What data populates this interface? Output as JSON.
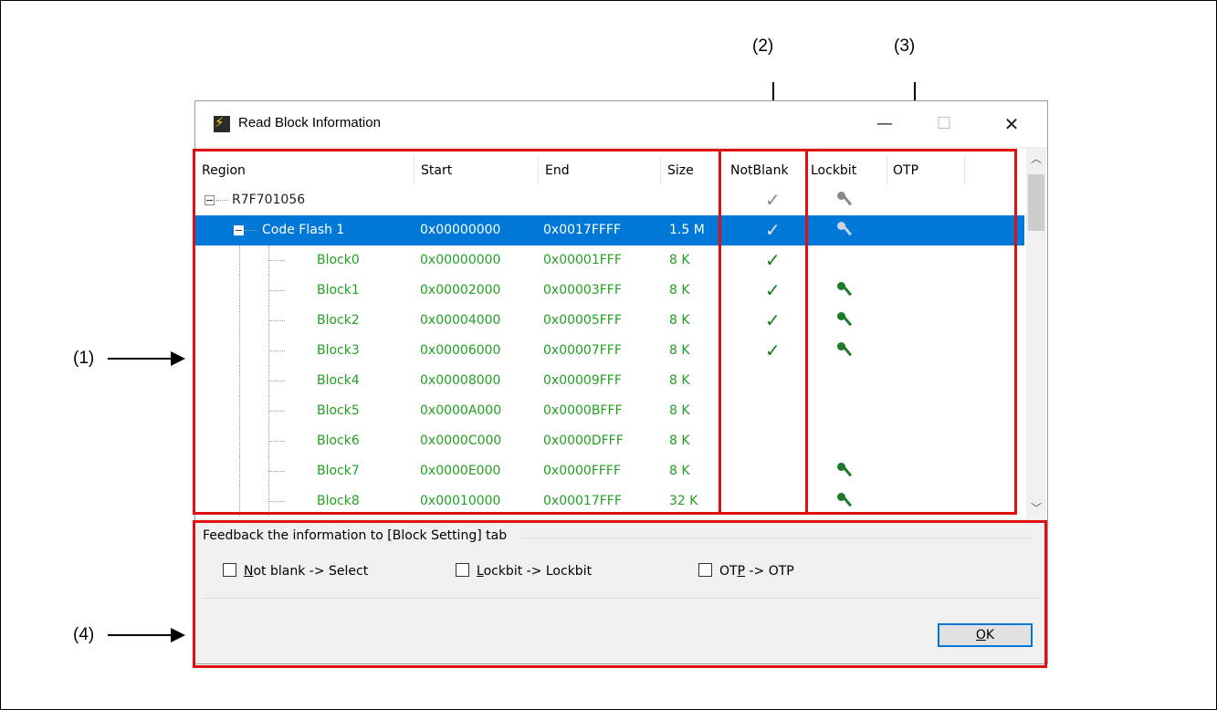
{
  "callouts": {
    "c1": "(1)",
    "c2": "(2)",
    "c3": "(3)",
    "c4": "(4)"
  },
  "window": {
    "title": "Read Block Information",
    "minimize": "—",
    "maximize": "☐",
    "close": "✕"
  },
  "columns": {
    "region": "Region",
    "start": "Start",
    "end": "End",
    "size": "Size",
    "notblank": "NotBlank",
    "lockbit": "Lockbit",
    "otp": "OTP"
  },
  "rows": [
    {
      "region": "R7F701056",
      "start": "",
      "end": "",
      "size": "",
      "notblank": true,
      "lockbit": true,
      "level": 0
    },
    {
      "region": "Code Flash 1",
      "start": "0x00000000",
      "end": "0x0017FFFF",
      "size": "1.5 M",
      "notblank": true,
      "lockbit": true,
      "level": 1,
      "selected": true
    },
    {
      "region": "Block0",
      "start": "0x00000000",
      "end": "0x00001FFF",
      "size": "8 K",
      "notblank": true,
      "lockbit": false,
      "level": 2
    },
    {
      "region": "Block1",
      "start": "0x00002000",
      "end": "0x00003FFF",
      "size": "8 K",
      "notblank": true,
      "lockbit": true,
      "level": 2
    },
    {
      "region": "Block2",
      "start": "0x00004000",
      "end": "0x00005FFF",
      "size": "8 K",
      "notblank": true,
      "lockbit": true,
      "level": 2
    },
    {
      "region": "Block3",
      "start": "0x00006000",
      "end": "0x00007FFF",
      "size": "8 K",
      "notblank": true,
      "lockbit": true,
      "level": 2
    },
    {
      "region": "Block4",
      "start": "0x00008000",
      "end": "0x00009FFF",
      "size": "8 K",
      "notblank": false,
      "lockbit": false,
      "level": 2
    },
    {
      "region": "Block5",
      "start": "0x0000A000",
      "end": "0x0000BFFF",
      "size": "8 K",
      "notblank": false,
      "lockbit": false,
      "level": 2
    },
    {
      "region": "Block6",
      "start": "0x0000C000",
      "end": "0x0000DFFF",
      "size": "8 K",
      "notblank": false,
      "lockbit": false,
      "level": 2
    },
    {
      "region": "Block7",
      "start": "0x0000E000",
      "end": "0x0000FFFF",
      "size": "8 K",
      "notblank": false,
      "lockbit": true,
      "level": 2
    },
    {
      "region": "Block8",
      "start": "0x00010000",
      "end": "0x00017FFF",
      "size": "32 K",
      "notblank": false,
      "lockbit": true,
      "level": 2
    }
  ],
  "feedback": {
    "group_label": "Feedback the information to [Block Setting] tab",
    "not_blank_pre": "",
    "not_blank_mn": "N",
    "not_blank_post": "ot blank -> Select",
    "lockbit_mn": "L",
    "lockbit_post": "ockbit -> Lockbit",
    "otp_pre": "OT",
    "otp_mn": "P",
    "otp_post": " -> OTP",
    "ok_mn": "O",
    "ok_post": "K"
  },
  "colors": {
    "highlight_red": "#e01010",
    "selection_blue": "#0078d7",
    "block_text_green": "#22a022"
  },
  "icons": {
    "app": "app-lightning-icon",
    "check": "checkmark-icon",
    "key": "key-icon"
  }
}
